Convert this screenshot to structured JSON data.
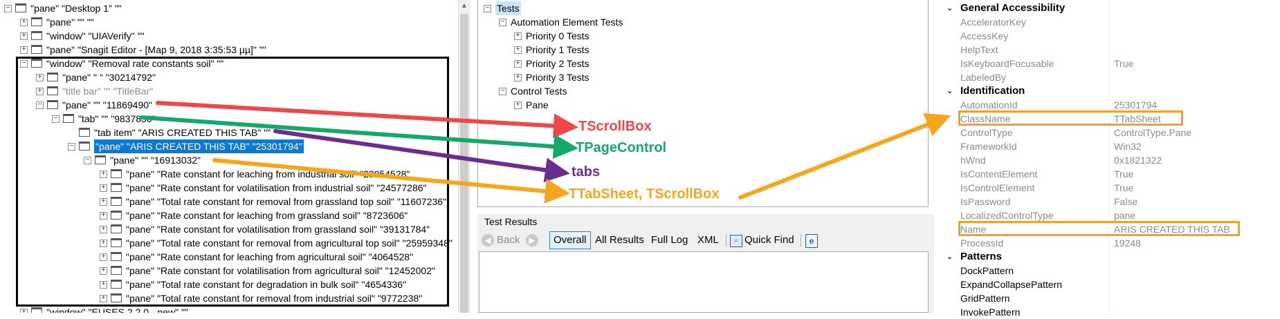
{
  "tree": {
    "nodes": [
      {
        "text": "\"pane\" \"Desktop 1\" \"\"",
        "indent": 0,
        "expander": "−",
        "gray": false
      },
      {
        "text": "\"pane\" \"\" \"\"",
        "indent": 1,
        "expander": "+",
        "gray": false
      },
      {
        "text": "\"window\" \"UIAVerify\" \"\"",
        "indent": 1,
        "expander": "+",
        "gray": false
      },
      {
        "text": "\"pane\" \"Snagit Editor - [Мар 9, 2018 3:35:53 µµ]\" \"\"",
        "indent": 1,
        "expander": "+",
        "gray": false
      },
      {
        "text": "\"window\" \"Removal rate constants soil\" \"\"",
        "indent": 1,
        "expander": "−",
        "gray": false
      },
      {
        "text": "\"pane\" \" \" \"30214792\"",
        "indent": 2,
        "expander": "+",
        "gray": false
      },
      {
        "text": "\"title bar\" \"\" \"TitleBar\"",
        "indent": 2,
        "expander": "+",
        "gray": true
      },
      {
        "text": "\"pane\" \"\" \"11869490\"",
        "indent": 2,
        "expander": "−",
        "gray": false
      },
      {
        "text": "\"tab\" \"\" \"9837836\"",
        "indent": 3,
        "expander": "−",
        "gray": false
      },
      {
        "text": "\"tab item\" \"ARIS CREATED THIS TAB\" \"\"",
        "indent": 4,
        "expander": "",
        "gray": false
      },
      {
        "text": "\"pane\" \"ARIS CREATED THIS TAB\" \"25301794\"",
        "indent": 4,
        "expander": "−",
        "gray": false,
        "selected": true
      },
      {
        "text": "\"pane\" \"\" \"16913032\"",
        "indent": 5,
        "expander": "−",
        "gray": false
      },
      {
        "text": "\"pane\" \"Rate constant for leaching from industrial soil\" \"23954528\"",
        "indent": 6,
        "expander": "+",
        "gray": false
      },
      {
        "text": "\"pane\" \"Rate constant for volatilisation from industrial soil\" \"24577286\"",
        "indent": 6,
        "expander": "+",
        "gray": false
      },
      {
        "text": "\"pane\" \"Total rate constant for removal from grassland top soil\" \"11607236\"",
        "indent": 6,
        "expander": "+",
        "gray": false
      },
      {
        "text": "\"pane\" \"Rate constant for leaching from grassland soil\" \"8723606\"",
        "indent": 6,
        "expander": "+",
        "gray": false
      },
      {
        "text": "\"pane\" \"Rate constant for volatilisation from grassland soil\" \"39131784\"",
        "indent": 6,
        "expander": "+",
        "gray": false
      },
      {
        "text": "\"pane\" \"Total rate constant for removal from agricultural top soil\" \"25959348\"",
        "indent": 6,
        "expander": "+",
        "gray": false
      },
      {
        "text": "\"pane\" \"Rate constant for leaching from agricultural soil\" \"4064528\"",
        "indent": 6,
        "expander": "+",
        "gray": false
      },
      {
        "text": "\"pane\" \"Rate constant for volatilisation from agricultural soil\" \"12452002\"",
        "indent": 6,
        "expander": "+",
        "gray": false
      },
      {
        "text": "\"pane\" \"Total rate constant for degradation in bulk soil\" \"4654336\"",
        "indent": 6,
        "expander": "+",
        "gray": false
      },
      {
        "text": "\"pane\" \"Total rate constant for removal from industrial soil\" \"9772238\"",
        "indent": 6,
        "expander": "+",
        "gray": false
      },
      {
        "text": "\"window\" \"EUSES 2.2.0 - new\" \"\"",
        "indent": 1,
        "expander": "+",
        "gray": false
      }
    ]
  },
  "tests": {
    "nodes": [
      {
        "text": "Tests",
        "indent": 0,
        "expander": "−",
        "selected": true
      },
      {
        "text": "Automation Element Tests",
        "indent": 1,
        "expander": "−"
      },
      {
        "text": "Priority 0 Tests",
        "indent": 2,
        "expander": "+"
      },
      {
        "text": "Priority 1 Tests",
        "indent": 2,
        "expander": "+"
      },
      {
        "text": "Priority 2 Tests",
        "indent": 2,
        "expander": "+"
      },
      {
        "text": "Priority 3 Tests",
        "indent": 2,
        "expander": "+"
      },
      {
        "text": "Control Tests",
        "indent": 1,
        "expander": "−"
      },
      {
        "text": "Pane",
        "indent": 2,
        "expander": "+"
      }
    ]
  },
  "results": {
    "title": "Test Results",
    "back_label": "Back",
    "tabs": [
      "Overall",
      "All Results",
      "Full Log",
      "XML"
    ],
    "quick_find_label": "Quick Find"
  },
  "properties": {
    "groups": [
      {
        "name": "General Accessibility",
        "rows": [
          {
            "name": "AcceleratorKey",
            "value": ""
          },
          {
            "name": "AccessKey",
            "value": ""
          },
          {
            "name": "HelpText",
            "value": ""
          },
          {
            "name": "IsKeyboardFocusable",
            "value": "True"
          },
          {
            "name": "LabeledBy",
            "value": ""
          }
        ]
      },
      {
        "name": "Identification",
        "rows": [
          {
            "name": "AutomationId",
            "value": "25301794"
          },
          {
            "name": "ClassName",
            "value": "TTabSheet",
            "highlight": true
          },
          {
            "name": "ControlType",
            "value": "ControlType.Pane"
          },
          {
            "name": "FrameworkId",
            "value": "Win32"
          },
          {
            "name": "hWnd",
            "value": "0x1821322"
          },
          {
            "name": "IsContentElement",
            "value": "True"
          },
          {
            "name": "IsControlElement",
            "value": "True"
          },
          {
            "name": "IsPassword",
            "value": "False"
          },
          {
            "name": "LocalizedControlType",
            "value": "pane"
          },
          {
            "name": "Name",
            "value": "ARIS CREATED THIS TAB",
            "highlight": true
          },
          {
            "name": "ProcessId",
            "value": "19248"
          }
        ]
      },
      {
        "name": "Patterns",
        "rows": [
          {
            "name": "DockPattern",
            "value": "",
            "dark": true
          },
          {
            "name": "ExpandCollapsePattern",
            "value": "",
            "dark": true
          },
          {
            "name": "GridPattern",
            "value": "",
            "dark": true
          },
          {
            "name": "InvokePattern",
            "value": "",
            "dark": true
          }
        ]
      }
    ]
  },
  "annotations": [
    {
      "text": "TScrollBox",
      "color": "#f0474a"
    },
    {
      "text": "TPageControl",
      "color": "#16a86a"
    },
    {
      "text": "tabs",
      "color": "#6b2d8f"
    },
    {
      "text": "TTabSheet, TScrollBox",
      "color": "#f4a61c"
    }
  ]
}
